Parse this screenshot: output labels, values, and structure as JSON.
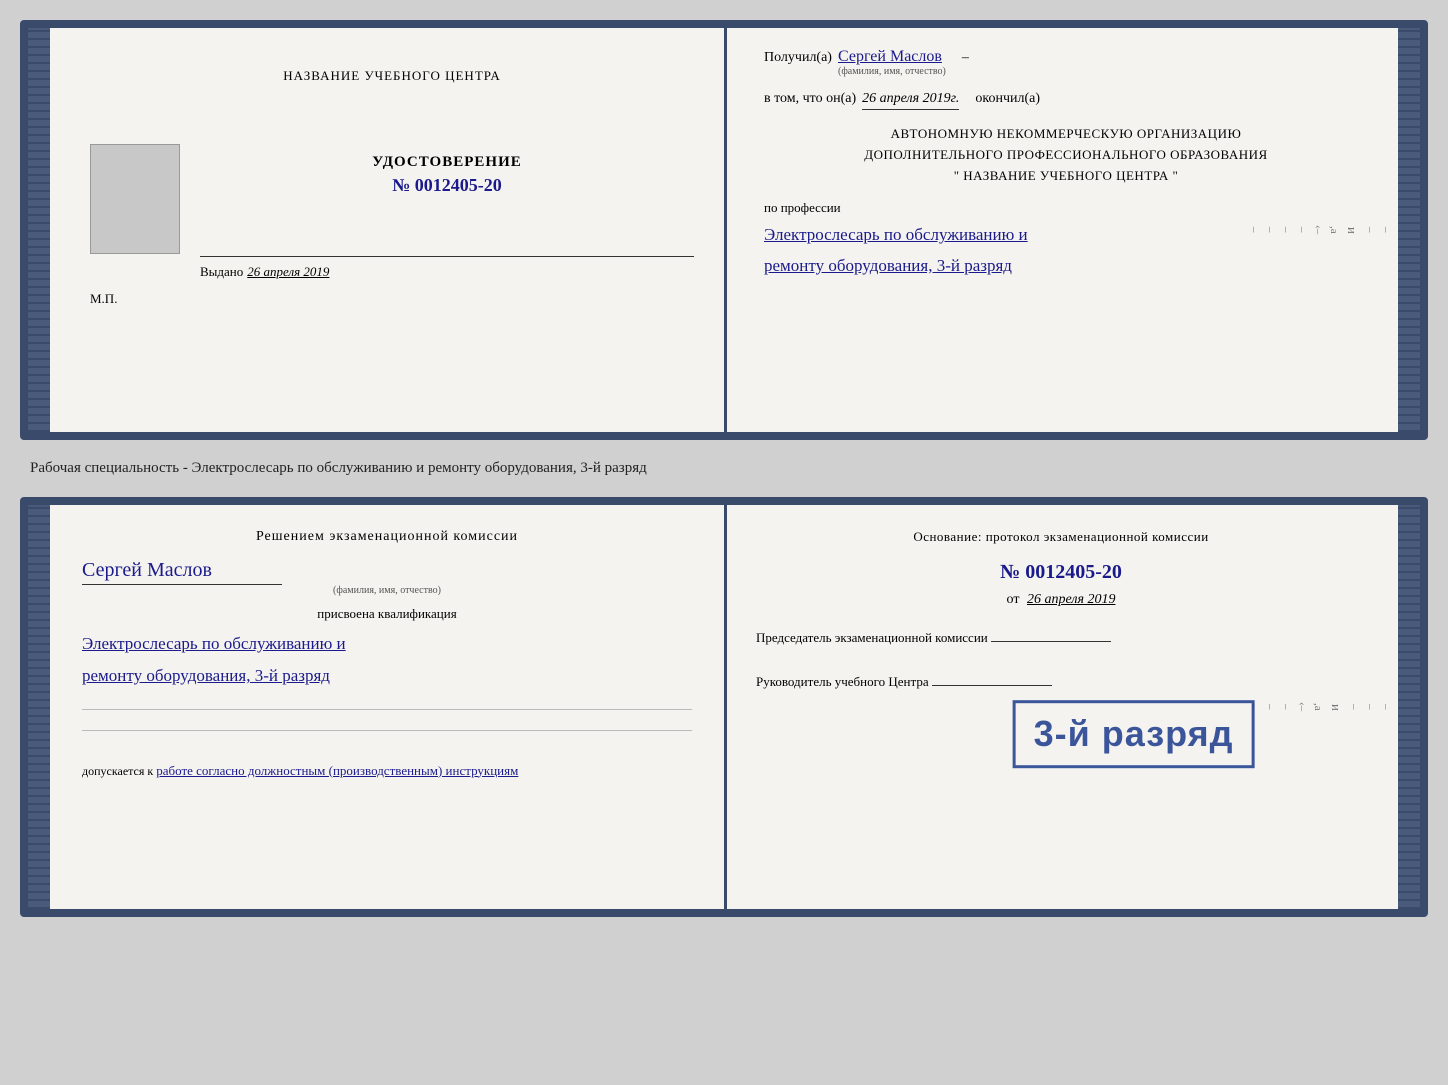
{
  "doc1": {
    "left": {
      "title": "НАЗВАНИЕ УЧЕБНОГО ЦЕНТРА",
      "udostoverenie_label": "УДОСТОВЕРЕНИЕ",
      "udostoverenie_num": "№ 0012405-20",
      "vydano_label": "Выдано",
      "vydano_date": "26 апреля 2019",
      "mp_label": "М.П."
    },
    "right": {
      "poluchil_label": "Получил(а)",
      "poluchil_name": "Сергей Маслов",
      "fio_sublabel": "(фамилия, имя, отчество)",
      "vtom_label": "в том, что он(а)",
      "vtom_date": "26 апреля 2019г.",
      "okonchil_label": "окончил(а)",
      "org_line1": "АВТОНОМНУЮ НЕКОММЕРЧЕСКУЮ ОРГАНИЗАЦИЮ",
      "org_line2": "ДОПОЛНИТЕЛЬНОГО ПРОФЕССИОНАЛЬНОГО ОБРАЗОВАНИЯ",
      "org_line3": "\"   НАЗВАНИЕ УЧЕБНОГО ЦЕНТРА   \"",
      "po_professii_label": "по профессии",
      "profession_line1": "Электрослесарь по обслуживанию и",
      "profession_line2": "ремонту оборудования, 3-й разряд"
    }
  },
  "between_label": "Рабочая специальность - Электрослесарь по обслуживанию и ремонту оборудования, 3-й разряд",
  "doc2": {
    "left": {
      "resheniem_title": "Решением  экзаменационной  комиссии",
      "name": "Сергей Маслов",
      "fio_sublabel": "(фамилия, имя, отчество)",
      "prisvoyena_label": "присвоена квалификация",
      "qual_line1": "Электрослесарь по обслуживанию и",
      "qual_line2": "ремонту оборудования, 3-й разряд",
      "dopuskaetsya_prefix": "допускается к",
      "dopuskaetsya_text": "работе согласно должностным (производственным) инструкциям"
    },
    "right": {
      "osnovanie_label": "Основание: протокол экзаменационной комиссии",
      "protocol_num": "№  0012405-20",
      "ot_label": "от",
      "ot_date": "26 апреля 2019",
      "predsedatel_label": "Председатель экзаменационной комиссии",
      "rukovoditel_label": "Руководитель учебного Центра"
    },
    "stamp": "3-й разряд"
  }
}
